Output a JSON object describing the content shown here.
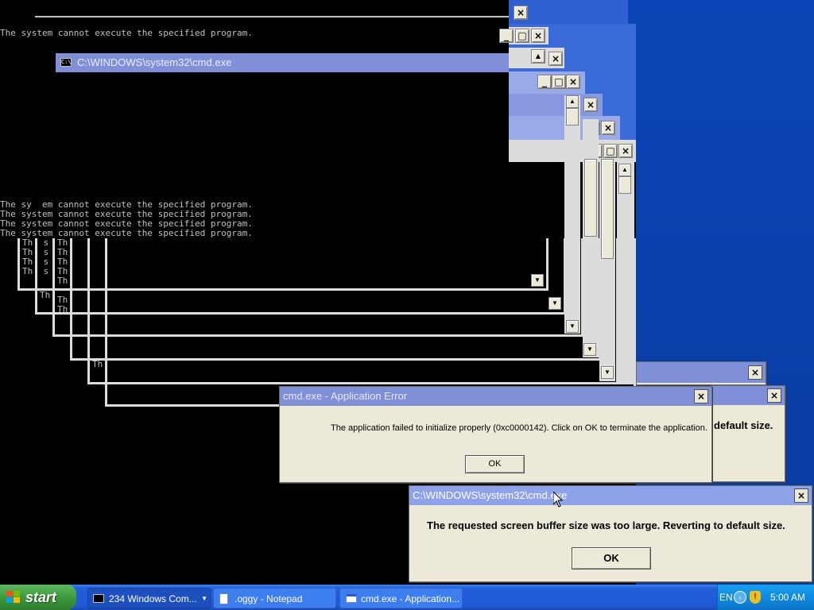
{
  "console": {
    "top_line": "The system cannot execute the specified program.",
    "line_broken": "The sy  em cannot execute the specified program.",
    "lines": [
      "The system cannot execute the specified program.",
      "The system cannot execute the specified program.",
      "The system cannot execute the specified program."
    ],
    "fragments": [
      "Th  s",
      "Th  s",
      "Th  s",
      "Th  s"
    ],
    "frag_th": "Th"
  },
  "cmd_window": {
    "title": "C:\\WINDOWS\\system32\\cmd.exe"
  },
  "app_error_dialog": {
    "title": "cmd.exe - Application Error",
    "message": "The application failed to initialize properly (0xc0000142). Click on OK to terminate the application.",
    "ok": "OK"
  },
  "behind_dialog": {
    "message_tail": "default size."
  },
  "buffer_dialog": {
    "title": "C:\\WINDOWS\\system32\\cmd.exe",
    "message": "The requested screen buffer size was too large. Reverting to default size.",
    "ok": "OK"
  },
  "taskbar": {
    "start_label": "start",
    "buttons": [
      {
        "label": "234 Windows Com...",
        "icon": "cmd-icon"
      },
      {
        "label": ".oggy - Notepad",
        "icon": "notepad-icon"
      },
      {
        "label": "cmd.exe - Application...",
        "icon": "window-icon"
      }
    ],
    "tray": {
      "language": "EN",
      "clock": "5:00 AM"
    }
  },
  "colors": {
    "desktop": "#0a3fa8",
    "title_inactive": "#7f8fd8",
    "dialog_face": "#ece9d8",
    "taskbar": "#245edb"
  }
}
